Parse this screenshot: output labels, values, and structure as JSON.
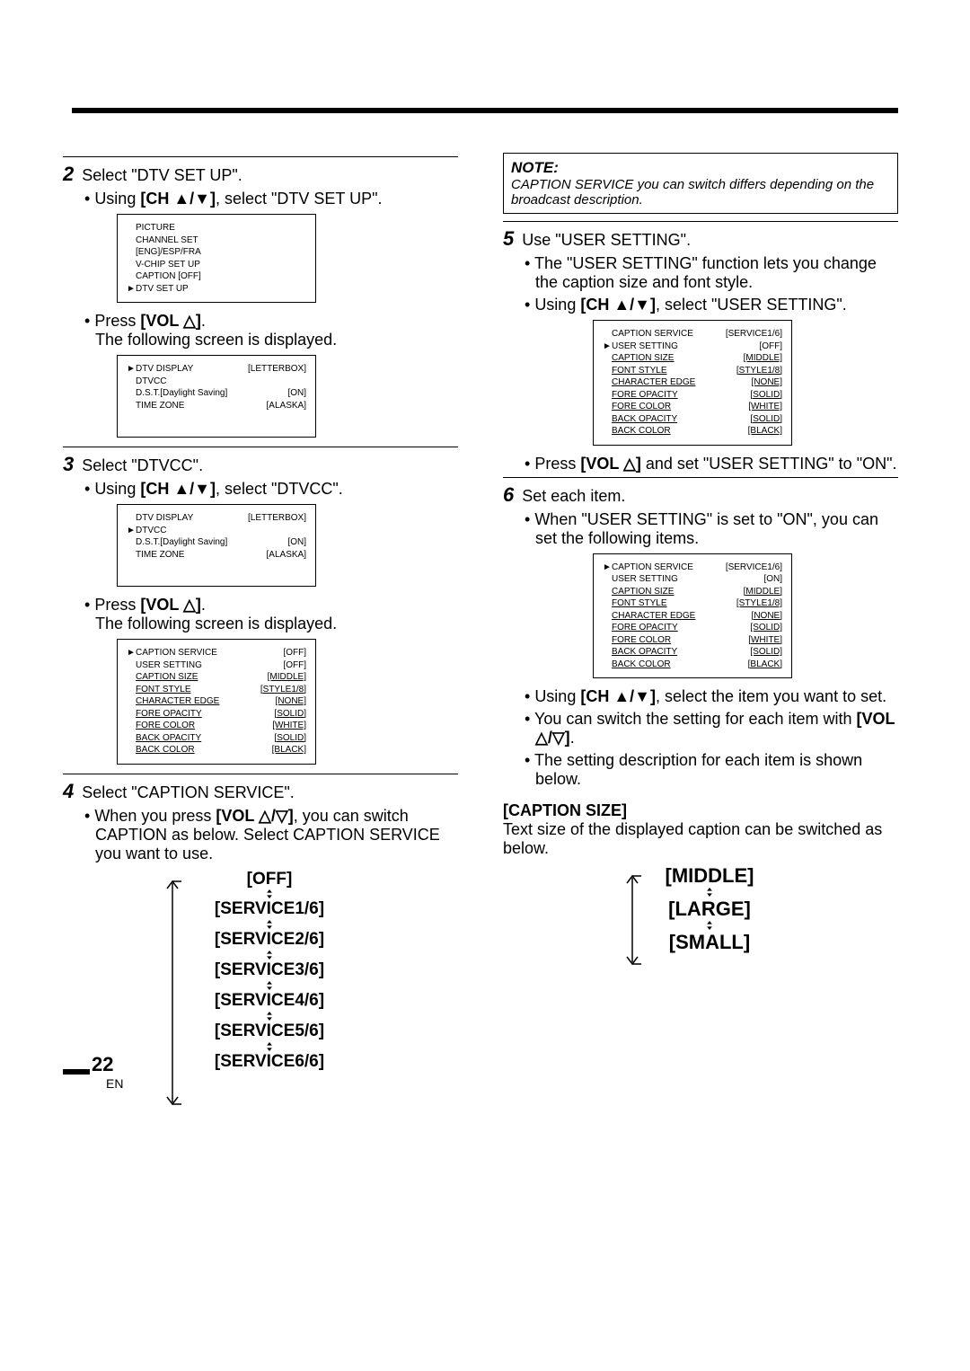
{
  "page_number": "22",
  "page_lang": "EN",
  "left": {
    "step2": {
      "title": "Select \"DTV SET UP\".",
      "bullet1": ", select \"DTV SET UP\".",
      "bullet1_pre": "Using ",
      "bullet1_btn": "[CH ▲/▼]",
      "menu": [
        {
          "label": "PICTURE"
        },
        {
          "label": "CHANNEL SET"
        },
        {
          "label": "[ENG]/ESP/FRA"
        },
        {
          "label": "V-CHIP SET UP"
        },
        {
          "label": "CAPTION [OFF]"
        },
        {
          "label": "DTV SET UP",
          "sel": true
        }
      ],
      "bullet2_pre": "Press ",
      "bullet2_btn": "[VOL △]",
      "bullet2_post": ".",
      "bullet2_line2": "The following screen is displayed.",
      "menu2": [
        {
          "label": "DTV DISPLAY",
          "value": "[LETTERBOX]",
          "sel": true
        },
        {
          "label": "DTVCC"
        },
        {
          "label": "D.S.T.[Daylight Saving]",
          "value": "[ON]"
        },
        {
          "label": "TIME ZONE",
          "value": "[ALASKA]"
        }
      ]
    },
    "step3": {
      "title": "Select \"DTVCC\".",
      "bullet1_pre": "Using ",
      "bullet1_btn": "[CH ▲/▼]",
      "bullet1_post": ", select \"DTVCC\".",
      "menu": [
        {
          "label": "DTV DISPLAY",
          "value": "[LETTERBOX]"
        },
        {
          "label": "DTVCC",
          "sel": true
        },
        {
          "label": "D.S.T.[Daylight Saving]",
          "value": "[ON]"
        },
        {
          "label": "TIME ZONE",
          "value": "[ALASKA]"
        }
      ],
      "bullet2_pre": "Press ",
      "bullet2_btn": "[VOL △]",
      "bullet2_post": ".",
      "bullet2_line2": "The following screen is displayed.",
      "menu2": [
        {
          "label": "CAPTION SERVICE",
          "value": "[OFF]",
          "sel": true
        },
        {
          "label": "USER SETTING",
          "value": "[OFF]"
        },
        {
          "label": "CAPTION SIZE",
          "value": "[MIDDLE]",
          "under": true
        },
        {
          "label": "FONT STYLE",
          "value": "[STYLE1/8]",
          "under": true
        },
        {
          "label": "CHARACTER EDGE",
          "value": "[NONE]",
          "under": true
        },
        {
          "label": "FORE OPACITY",
          "value": "[SOLID]",
          "under": true
        },
        {
          "label": "FORE COLOR",
          "value": "[WHITE]",
          "under": true
        },
        {
          "label": "BACK OPACITY",
          "value": "[SOLID]",
          "under": true
        },
        {
          "label": "BACK COLOR",
          "value": "[BLACK]",
          "under": true
        }
      ]
    },
    "step4": {
      "title": "Select \"CAPTION SERVICE\".",
      "bullet_pre": "When you press ",
      "bullet_btn": "[VOL △/▽]",
      "bullet_post": ", you can switch CAPTION as below. Select CAPTION SERVICE you want to use.",
      "flow": [
        "[OFF]",
        "[SERVICE1/6]",
        "[SERVICE2/6]",
        "[SERVICE3/6]",
        "[SERVICE4/6]",
        "[SERVICE5/6]",
        "[SERVICE6/6]"
      ]
    }
  },
  "right": {
    "note_title": "NOTE:",
    "note_text": "CAPTION SERVICE you can switch differs depending on the broadcast description.",
    "step5": {
      "title": "Use \"USER SETTING\".",
      "bullet1": "The \"USER SETTING\" function lets you change the caption size and font style.",
      "bullet2_pre": "Using ",
      "bullet2_btn": "[CH ▲/▼]",
      "bullet2_post": ", select \"USER SETTING\".",
      "menu": [
        {
          "label": "CAPTION SERVICE",
          "value": "[SERVICE1/6]"
        },
        {
          "label": "USER SETTING",
          "value": "[OFF]",
          "sel": true
        },
        {
          "label": "CAPTION SIZE",
          "value": "[MIDDLE]",
          "under": true
        },
        {
          "label": "FONT STYLE",
          "value": "[STYLE1/8]",
          "under": true
        },
        {
          "label": "CHARACTER EDGE",
          "value": "[NONE]",
          "under": true
        },
        {
          "label": "FORE OPACITY",
          "value": "[SOLID]",
          "under": true
        },
        {
          "label": "FORE COLOR",
          "value": "[WHITE]",
          "under": true
        },
        {
          "label": "BACK OPACITY",
          "value": "[SOLID]",
          "under": true
        },
        {
          "label": "BACK COLOR",
          "value": "[BLACK]",
          "under": true
        }
      ],
      "bullet3_pre": "Press ",
      "bullet3_btn": "[VOL △]",
      "bullet3_post": " and set \"USER SETTING\" to \"ON\"."
    },
    "step6": {
      "title": "Set each item.",
      "bullet1": "When \"USER SETTING\" is set to \"ON\", you can set the following items.",
      "menu": [
        {
          "label": "CAPTION SERVICE",
          "value": "[SERVICE1/6]",
          "sel": true
        },
        {
          "label": "USER SETTING",
          "value": "[ON]"
        },
        {
          "label": "CAPTION SIZE",
          "value": "[MIDDLE]",
          "under": true
        },
        {
          "label": "FONT STYLE",
          "value": "[STYLE1/8]",
          "under": true
        },
        {
          "label": "CHARACTER EDGE",
          "value": "[NONE]",
          "under": true
        },
        {
          "label": "FORE OPACITY",
          "value": "[SOLID]",
          "under": true
        },
        {
          "label": "FORE COLOR",
          "value": "[WHITE]",
          "under": true
        },
        {
          "label": "BACK OPACITY",
          "value": "[SOLID]",
          "under": true
        },
        {
          "label": "BACK COLOR",
          "value": "[BLACK]",
          "under": true
        }
      ],
      "bullet2_pre": "Using ",
      "bullet2_btn": "[CH ▲/▼]",
      "bullet2_post": ", select the item you want to set.",
      "bullet3_pre": "You can switch the setting for each item with ",
      "bullet3_btn": "[VOL △/▽]",
      "bullet3_post": ".",
      "bullet4": "The setting description for each item is shown below."
    },
    "caption_size": {
      "head": "[CAPTION SIZE]",
      "text": "Text size of the displayed caption can be switched as below.",
      "flow": [
        "[MIDDLE]",
        "[LARGE]",
        "[SMALL]"
      ]
    }
  }
}
